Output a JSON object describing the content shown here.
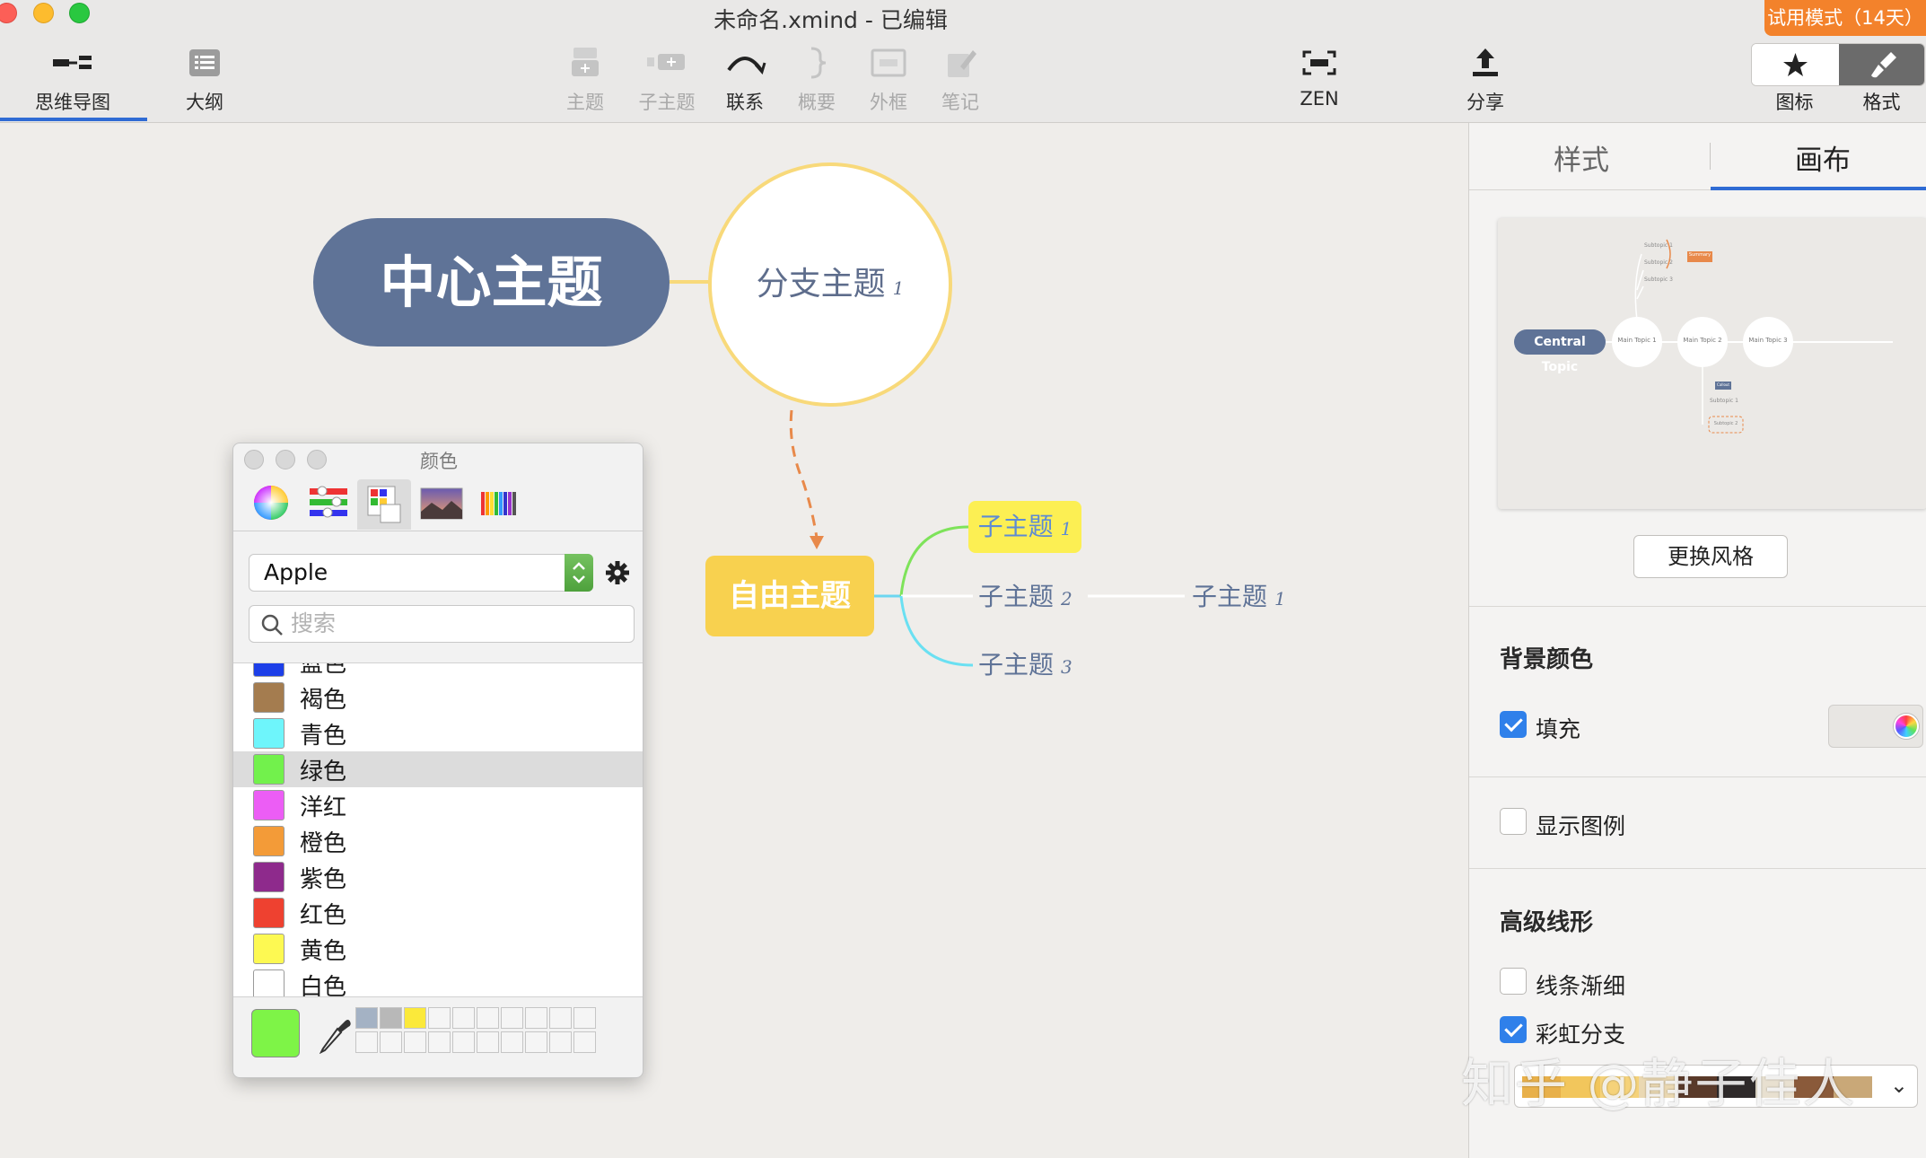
{
  "window": {
    "title": "未命名.xmind - 已编辑",
    "trial_badge": "试用模式（14天）"
  },
  "toolbar": {
    "mindmap": "思维导图",
    "outline": "大纲",
    "topic": "主题",
    "subtopic": "子主题",
    "relation": "联系",
    "summary": "概要",
    "boundary": "外框",
    "note": "笔记",
    "zen": "ZEN",
    "share": "分享",
    "icon": "图标",
    "format": "格式"
  },
  "mindmap": {
    "central": "中心主题",
    "branch": "分支主题",
    "branch_num": "1",
    "floating": "自由主题",
    "subtopics": [
      {
        "label": "子主题",
        "num": "1"
      },
      {
        "label": "子主题",
        "num": "2"
      },
      {
        "label": "子主题",
        "num": "3"
      }
    ],
    "sub2_child": {
      "label": "子主题",
      "num": "1"
    }
  },
  "color_panel": {
    "title": "颜色",
    "palette": "Apple",
    "search_placeholder": "搜索",
    "partial_item": "蓝色",
    "items": [
      {
        "label": "褐色",
        "color": "#a47c4f"
      },
      {
        "label": "青色",
        "color": "#6ef5fb"
      },
      {
        "label": "绿色",
        "color": "#72f14c",
        "selected": true
      },
      {
        "label": "洋红",
        "color": "#ec5df5"
      },
      {
        "label": "橙色",
        "color": "#f39b38"
      },
      {
        "label": "紫色",
        "color": "#8e2a8c"
      },
      {
        "label": "红色",
        "color": "#ee4130"
      },
      {
        "label": "黄色",
        "color": "#fdf952"
      },
      {
        "label": "白色",
        "color": "#ffffff"
      }
    ],
    "current_color": "#7ef447",
    "saved_swatches": [
      "#a4b2c4",
      "#b8b8b8",
      "#fbe93a"
    ]
  },
  "right_panel": {
    "tab_style": "样式",
    "tab_canvas": "画布",
    "preview": {
      "central": "Central Topic",
      "main1": "Main Topic 1",
      "main2": "Main Topic 2",
      "main3": "Main Topic 3",
      "sub1": "Subtopic 1",
      "sub2": "Subtopic 2",
      "sub3": "Subtopic 3",
      "summary": "Summary",
      "callout": "Callout",
      "lower_sub1": "Subtopic 1",
      "lower_sub2": "Subtopic 2"
    },
    "change_style": "更换风格",
    "bg_heading": "背景颜色",
    "fill_label": "填充",
    "fill_checked": true,
    "legend_label": "显示图例",
    "legend_checked": false,
    "advanced_heading": "高级线形",
    "taper_label": "线条渐细",
    "taper_checked": false,
    "rainbow_label": "彩虹分支",
    "rainbow_checked": true,
    "rainbow_colors": [
      "#e8b04a",
      "#f2c65c",
      "#f5d27a",
      "#ead8b2",
      "#5a3a2a",
      "#2e2a2a",
      "#e8e0d0",
      "#8a5a3a",
      "#c9a878"
    ]
  },
  "watermark": "知乎 @静子佳人",
  "colors": {
    "central_fill": "#5f7397",
    "floating_fill": "#f8d14f",
    "sub1_fill": "#fcef53",
    "accent_blue": "#2f6bd4",
    "relation_line": "#e8894a"
  }
}
